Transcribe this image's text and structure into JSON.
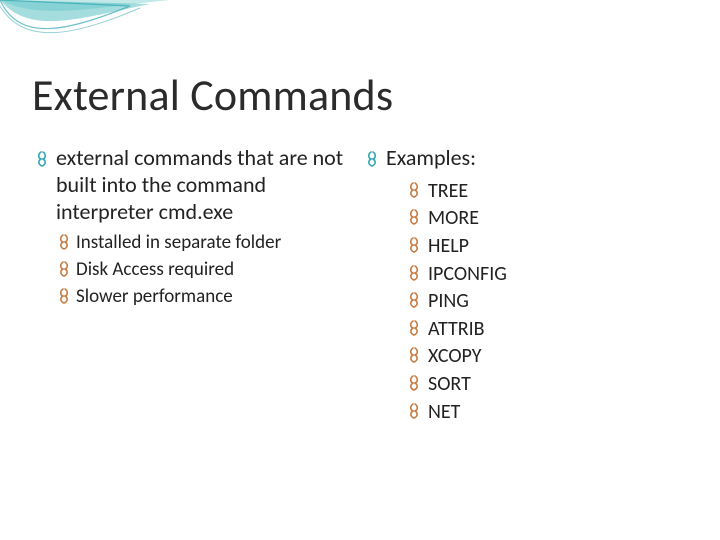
{
  "title": "External Commands",
  "left": {
    "main": "external commands that are not built into the command interpreter cmd.exe",
    "sub": [
      "Installed in separate folder",
      "Disk Access required",
      "Slower performance"
    ]
  },
  "right": {
    "heading": "Examples:",
    "items": [
      "TREE",
      "MORE",
      "HELP",
      "IPCONFIG",
      "PING",
      "ATTRIB",
      "XCOPY",
      "SORT",
      "NET"
    ]
  },
  "bullet_color_primary": "#2fa6b0",
  "bullet_color_sub": "#c77a3f"
}
